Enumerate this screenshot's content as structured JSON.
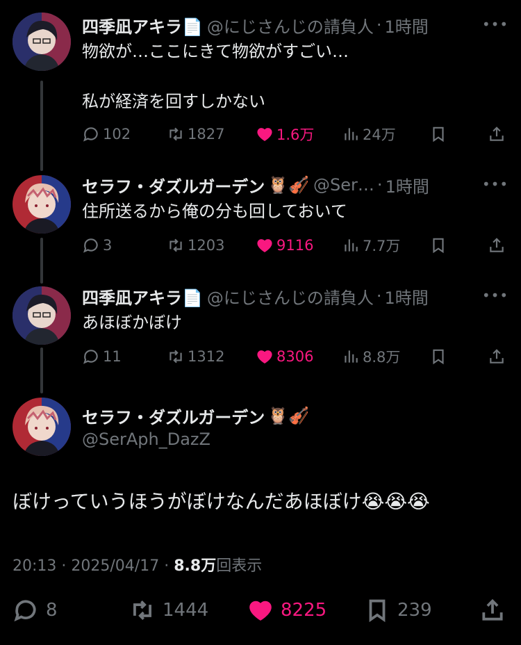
{
  "colors": {
    "background": "#000000",
    "text": "#e7e9ea",
    "muted": "#71767b",
    "like": "#f91880",
    "thread_line": "#333639"
  },
  "tweets": [
    {
      "name": "四季凪アキラ📄",
      "handle": "@にじさんじの請負人",
      "sep": "·",
      "time": "1時間",
      "text": "物欲が…ここにきて物欲がすごい…\n\n私が経済を回すしかない",
      "replies": "102",
      "retweets": "1827",
      "likes": "1.6万",
      "views": "24万"
    },
    {
      "name": "セラフ・ダズルガーデン",
      "emoji": "🦉🎻",
      "handle": "@Ser…",
      "sep": "·",
      "time": "1時間",
      "text": "住所送るから俺の分も回しておいて",
      "replies": "3",
      "retweets": "1203",
      "likes": "9116",
      "views": "7.7万"
    },
    {
      "name": "四季凪アキラ📄",
      "handle": "@にじさんじの請負人",
      "sep": "·",
      "time": "1時間",
      "text": "あほぼかぼけ",
      "replies": "11",
      "retweets": "1312",
      "likes": "8306",
      "views": "8.8万"
    }
  ],
  "main": {
    "name": "セラフ・ダズルガーデン",
    "emoji": "🦉🎻",
    "handle": "@SerAph_DazZ",
    "text": "ぼけっていうほうがぼけなんだあほぼけ😭😭😭",
    "time": "20:13",
    "date": "2025/04/17",
    "sep": "·",
    "views_count": "8.8万",
    "views_label": "回表示",
    "replies": "8",
    "retweets": "1444",
    "likes": "8225",
    "bookmarks": "239"
  },
  "more_label": "•••"
}
